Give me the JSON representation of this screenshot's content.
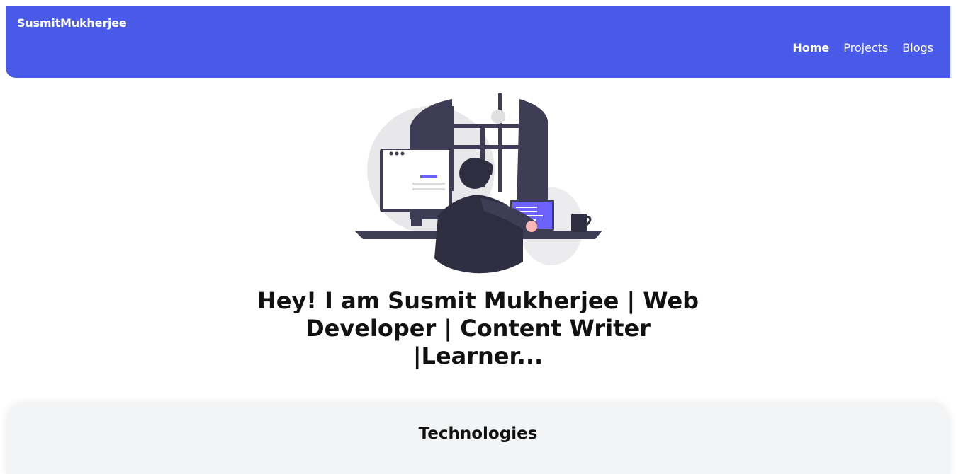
{
  "navbar": {
    "brand": "SusmitMukherjee",
    "links": [
      {
        "label": "Home",
        "active": true
      },
      {
        "label": "Projects",
        "active": false
      },
      {
        "label": "Blogs",
        "active": false
      }
    ],
    "color": "#4a5ae8"
  },
  "hero": {
    "illustration_icon": "developer-at-desk-illustration",
    "heading": "Hey! I am Susmit Mukherjee | Web Developer | Content Writer |Learner..."
  },
  "technologies": {
    "title": "Technologies"
  }
}
